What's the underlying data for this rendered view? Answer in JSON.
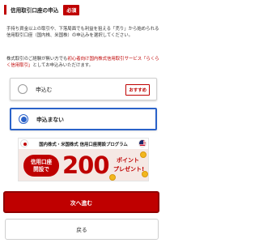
{
  "header": {
    "title": "信用取引口座の申込",
    "badge": "必須"
  },
  "description": {
    "paragraph1": "手持ち資金以上の取引や、下落局面でも利益を狙える「売り」から始められる信用取引口座（国内株、米国株）の申込みを選択してください。",
    "paragraph2_prefix": "株式取引のご経験が無い方でも",
    "paragraph2_link": "初心者向け国内株式信用取引サービス「らくらく信用取引」",
    "paragraph2_suffix": "としてお申込みいただけます。"
  },
  "options": [
    {
      "label": "申込む",
      "selected": false,
      "tag": "おすすめ"
    },
    {
      "label": "申込まない",
      "selected": true
    }
  ],
  "banner": {
    "top_text": "国内株式・米国株式 信用口座開設プログラム",
    "pill_line1": "信用口座",
    "pill_line2": "開設で",
    "amount": "200",
    "points_line1": "ポイント",
    "points_line2": "プレゼント!"
  },
  "buttons": {
    "next": "次へ進む",
    "back": "戻る"
  },
  "colors": {
    "brand_red": "#bf0000",
    "selected_blue": "#2a62c9"
  }
}
